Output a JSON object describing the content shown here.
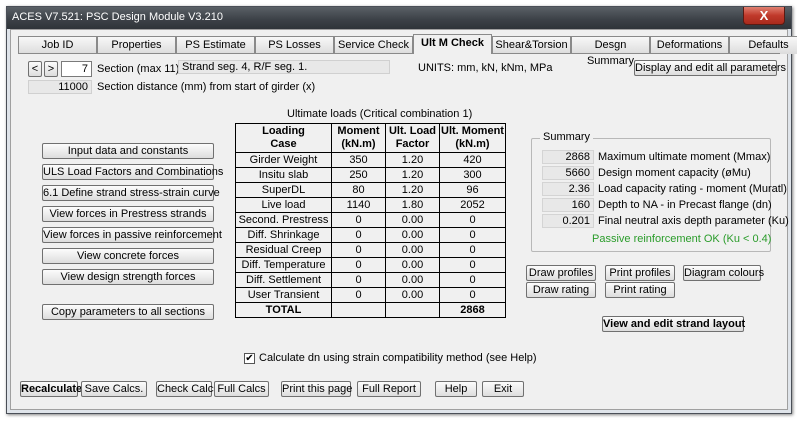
{
  "window": {
    "title": "ACES V7.521: PSC Design Module V3.210",
    "close_label": "X"
  },
  "tabs": [
    {
      "label": "Job ID"
    },
    {
      "label": "Properties"
    },
    {
      "label": "PS Estimate"
    },
    {
      "label": "PS Losses"
    },
    {
      "label": "Service Check"
    },
    {
      "label": "Ult M Check"
    },
    {
      "label": "Shear&Torsion"
    },
    {
      "label": "Desgn Summary"
    },
    {
      "label": "Deformations"
    },
    {
      "label": "Defaults"
    }
  ],
  "section": {
    "prev_label": "<",
    "next_label": ">",
    "value": "7",
    "label": "Section (max 11)",
    "strand_info": "Strand seg.  4, R/F seg.  1.",
    "units": "UNITS: mm, kN, kNm, MPa",
    "distance_value": "11000",
    "distance_label": "Section distance (mm) from start of girder (x)"
  },
  "display_all_button": "Display and edit all parameters",
  "left_buttons": [
    "Input data and constants",
    "ULS Load Factors and Combinations",
    "6.1 Define strand stress-strain curve",
    "View forces in Prestress strands",
    "View forces in passive reinforcement",
    "View concrete forces",
    "View design strength forces"
  ],
  "copy_button": "Copy parameters to all sections",
  "loads_table": {
    "caption": "Ultimate loads (Critical combination 1)",
    "headers": [
      "Loading\nCase",
      "Moment\n(kN.m)",
      "Ult. Load\nFactor",
      "Ult. Moment\n(kN.m)"
    ],
    "rows": [
      [
        "Girder Weight",
        "350",
        "1.20",
        "420"
      ],
      [
        "Insitu slab",
        "250",
        "1.20",
        "300"
      ],
      [
        "SuperDL",
        "80",
        "1.20",
        "96"
      ],
      [
        "Live load",
        "1140",
        "1.80",
        "2052"
      ],
      [
        "Second. Prestress",
        "0",
        "0.00",
        "0"
      ],
      [
        "Diff. Shrinkage",
        "0",
        "0.00",
        "0"
      ],
      [
        "Residual Creep",
        "0",
        "0.00",
        "0"
      ],
      [
        "Diff. Temperature",
        "0",
        "0.00",
        "0"
      ],
      [
        "Diff. Settlement",
        "0",
        "0.00",
        "0"
      ],
      [
        "User Transient",
        "0",
        "0.00",
        "0"
      ]
    ],
    "total": [
      "TOTAL",
      "",
      "",
      "2868"
    ]
  },
  "summary": {
    "legend": "Summary",
    "rows": [
      {
        "value": "2868",
        "label": "Maximum ultimate moment (Mmax)"
      },
      {
        "value": "5660",
        "label": "Design moment capacity (øMu)"
      },
      {
        "value": "2.36",
        "label": "Load capacity rating - moment (Muratl)"
      },
      {
        "value": "160",
        "label": "Depth to NA - in Precast flange (dn)"
      },
      {
        "value": "0.201",
        "label": "Final neutral axis depth parameter (Ku)"
      }
    ],
    "status": "Passive reinforcement OK (Ku < 0.4)",
    "status_color": "#2a9c2a"
  },
  "drawing_buttons": {
    "draw_profiles": "Draw profiles",
    "print_profiles": "Print profiles",
    "diagram_colours": "Diagram colours",
    "draw_rating": "Draw rating",
    "print_rating": "Print rating"
  },
  "strand_layout_button": "View and edit strand layout",
  "checkbox": {
    "checked": true,
    "mark": "✔",
    "label": "Calculate dn using strain compatibility method (see Help)"
  },
  "bottom_buttons": {
    "recalculate": "Recalculate",
    "save": "Save Calcs.",
    "check": "Check Calcs",
    "full_calcs": "Full Calcs",
    "print_page": "Print this page",
    "full_report": "Full Report",
    "help": "Help",
    "exit": "Exit"
  }
}
